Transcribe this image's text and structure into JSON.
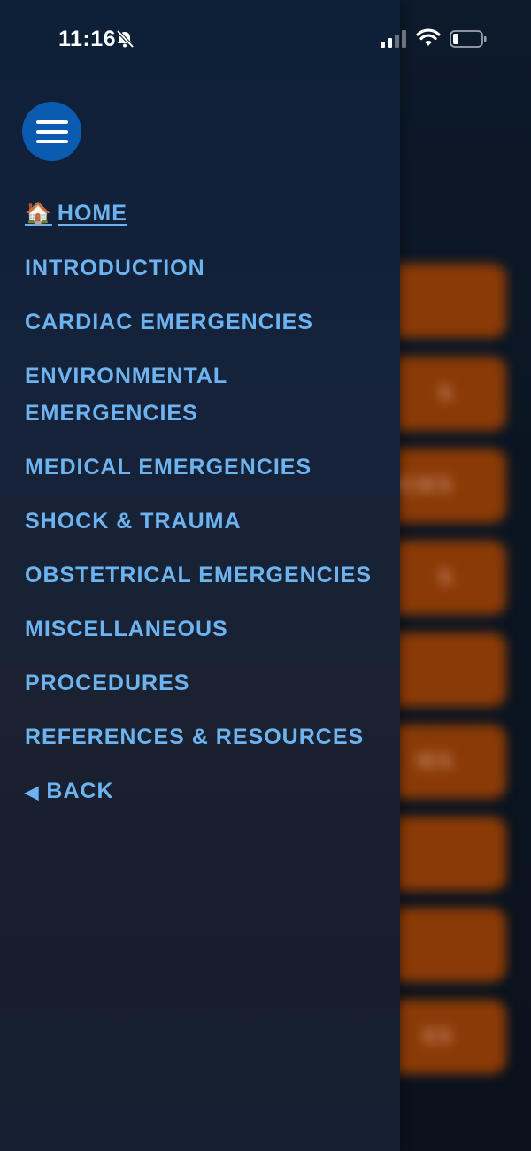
{
  "status_bar": {
    "time": "11:16",
    "icons": [
      "bell-slash-icon",
      "cellular-signal-icon",
      "wifi-icon",
      "battery-icon"
    ]
  },
  "drawer": {
    "menu_icon": "hamburger-icon",
    "items": [
      {
        "icon": "🏠",
        "label": "HOME",
        "active": true
      },
      {
        "label": "INTRODUCTION"
      },
      {
        "label": "CARDIAC EMERGENCIES"
      },
      {
        "label": "ENVIRONMENTAL EMERGENCIES"
      },
      {
        "label": "MEDICAL EMERGENCIES"
      },
      {
        "label": "SHOCK & TRAUMA"
      },
      {
        "label": "OBSTETRICAL EMERGENCIES"
      },
      {
        "label": "MISCELLANEOUS"
      },
      {
        "label": "PROCEDURES"
      },
      {
        "label": "REFERENCES & RESOURCES"
      },
      {
        "icon": "◀",
        "label": "BACK"
      }
    ]
  },
  "background": {
    "buttons": [
      "",
      "S",
      "ICIES",
      "S",
      "",
      "IES",
      "",
      "",
      "ES"
    ]
  },
  "colors": {
    "drawer_bg": "#15223a",
    "link": "#6cb3f0",
    "menu_button": "#0b5bb0",
    "bg_button": "#8a3a06"
  }
}
